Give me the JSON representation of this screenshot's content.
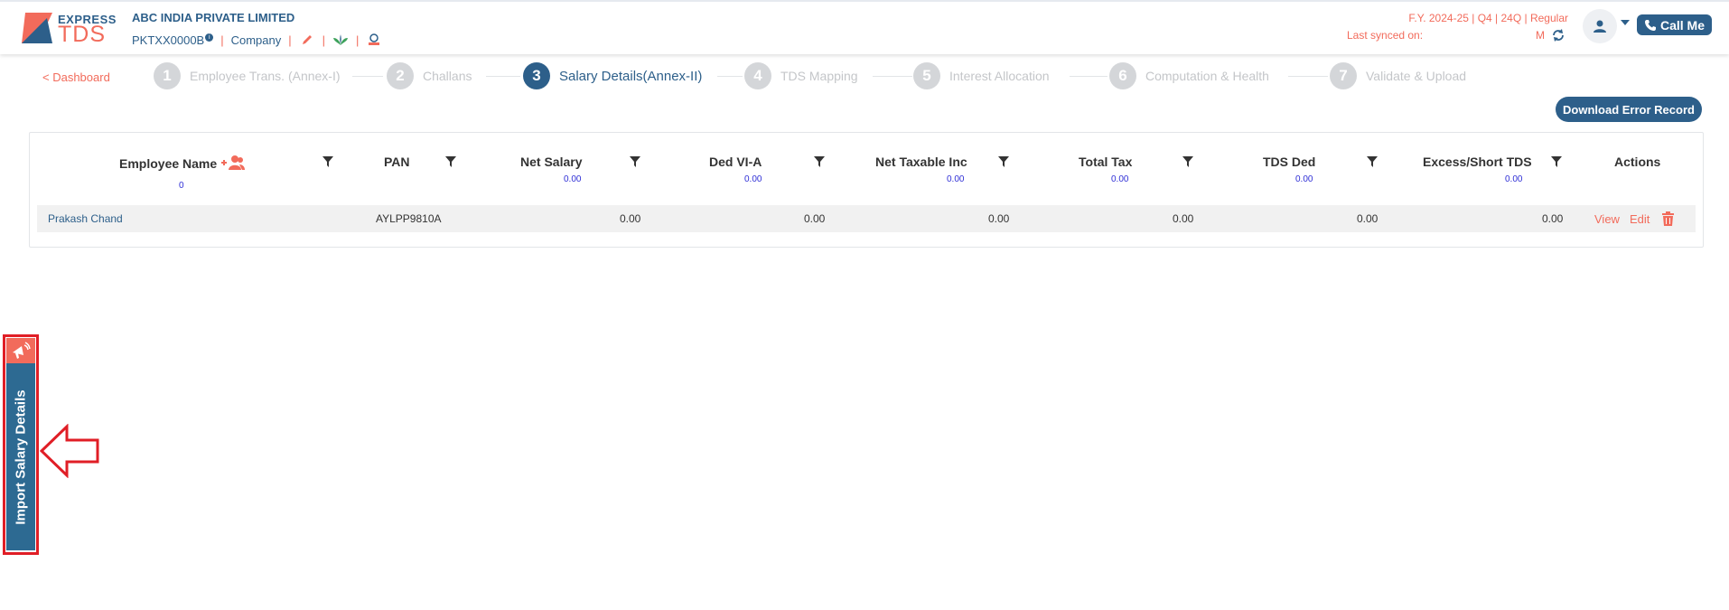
{
  "header": {
    "logo_express": "EXPRESS",
    "logo_tds": "TDS",
    "company_name": "ABC INDIA PRIVATE LIMITED",
    "company_code": "PKTXX0000B",
    "company_info_icon": "i",
    "company_type": "Company",
    "separator": "|",
    "fy_text": "F.Y. 2024-25  | Q4  | 24Q | Regular",
    "last_synced_label": "Last synced on:",
    "last_synced_value": "M",
    "call_me_label": "Call Me",
    "icons": [
      "edit-pencil-icon",
      "plant-icon",
      "badge-icon",
      "sync-icon",
      "user-icon",
      "phone-icon"
    ]
  },
  "stepper": {
    "back_link": "< Dashboard",
    "steps": [
      {
        "num": "1",
        "label": "Employee Trans. (Annex-I)"
      },
      {
        "num": "2",
        "label": "Challans"
      },
      {
        "num": "3",
        "label": "Salary Details(Annex-II)"
      },
      {
        "num": "4",
        "label": "TDS Mapping"
      },
      {
        "num": "5",
        "label": "Interest Allocation"
      },
      {
        "num": "6",
        "label": "Computation & Health"
      },
      {
        "num": "7",
        "label": "Validate & Upload"
      }
    ],
    "active_step": 3
  },
  "download_button": "Download Error Record",
  "table": {
    "columns": [
      {
        "label": "Employee Name",
        "sub": "0"
      },
      {
        "label": "PAN",
        "sub": ""
      },
      {
        "label": "Net Salary",
        "sub": "0.00"
      },
      {
        "label": "Ded VI-A",
        "sub": "0.00"
      },
      {
        "label": "Net Taxable Inc",
        "sub": "0.00"
      },
      {
        "label": "Total Tax",
        "sub": "0.00"
      },
      {
        "label": "TDS Ded",
        "sub": "0.00"
      },
      {
        "label": "Excess/Short TDS",
        "sub": "0.00"
      },
      {
        "label": "Actions",
        "sub": ""
      }
    ],
    "rows": [
      {
        "name": "Prakash Chand",
        "pan": "AYLPP9810A",
        "net_salary": "0.00",
        "ded_via": "0.00",
        "net_taxable": "0.00",
        "total_tax": "0.00",
        "tds_ded": "0.00",
        "excess_short": "0.00",
        "view": "View",
        "edit": "Edit"
      }
    ]
  },
  "side_tab": {
    "label": "Import Salary Details",
    "icon": "megaphone-icon"
  },
  "colors": {
    "primary": "#2d5f8a",
    "accent": "#f26b5b",
    "highlight": "#e01e26"
  }
}
